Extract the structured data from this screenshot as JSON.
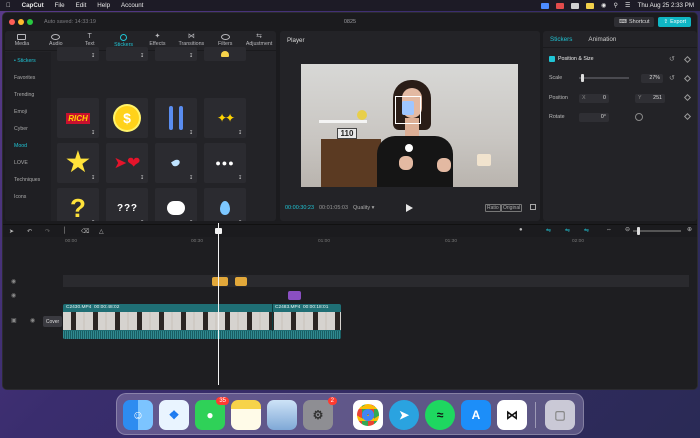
{
  "menubar": {
    "items": [
      "CapCut",
      "File",
      "Edit",
      "Help",
      "Account"
    ],
    "datetime": "Thu Aug 25 2:33 PM"
  },
  "window": {
    "autosave": "Auto saved: 14:33:19",
    "project_title": "0825",
    "shortcut_label": "Shortcut",
    "export_label": "Export"
  },
  "left_panel": {
    "tabs": [
      "Media",
      "Audio",
      "Text",
      "Stickers",
      "Effects",
      "Transitions",
      "Filters",
      "Adjustment"
    ],
    "active_tab": "Stickers",
    "categories": [
      "• Stickers",
      "Favorites",
      "Trending",
      "Emoji",
      "Cyber",
      "Mood",
      "LOVE",
      "Techniques",
      "Icons"
    ],
    "sticker_rich_text": "RICH"
  },
  "player": {
    "title": "Player",
    "current_time": "00:00:30:23",
    "duration": "00:01:05:03",
    "quality": "Quality",
    "ratio": "Ratio",
    "original": "Original",
    "scene_text": "110"
  },
  "properties": {
    "tabs": [
      "Stickers",
      "Animation"
    ],
    "section": "Position & Size",
    "scale_label": "Scale",
    "scale_value": "27%",
    "position_label": "Position",
    "pos_x_label": "X",
    "pos_x": "0",
    "pos_y_label": "Y",
    "pos_y": "251",
    "rotate_label": "Rotate",
    "rotate_value": "0°"
  },
  "timeline": {
    "ruler": [
      "00:00",
      "00:30",
      "01:00",
      "01:30",
      "02:00"
    ],
    "cover_label": "Cover",
    "clip1_name": "C2430.MP4",
    "clip1_dur": "00:00:48:02",
    "clip2_name": "C2483.MP4",
    "clip2_dur": "00:00:18:01"
  },
  "dock": {
    "messages_badge": "35",
    "settings_badge": "2"
  },
  "colors": {
    "accent": "#20c5d5",
    "clip": "#1f6f75",
    "sticker_clip": "#e2a83a",
    "effect_clip": "#8a4fc2"
  }
}
